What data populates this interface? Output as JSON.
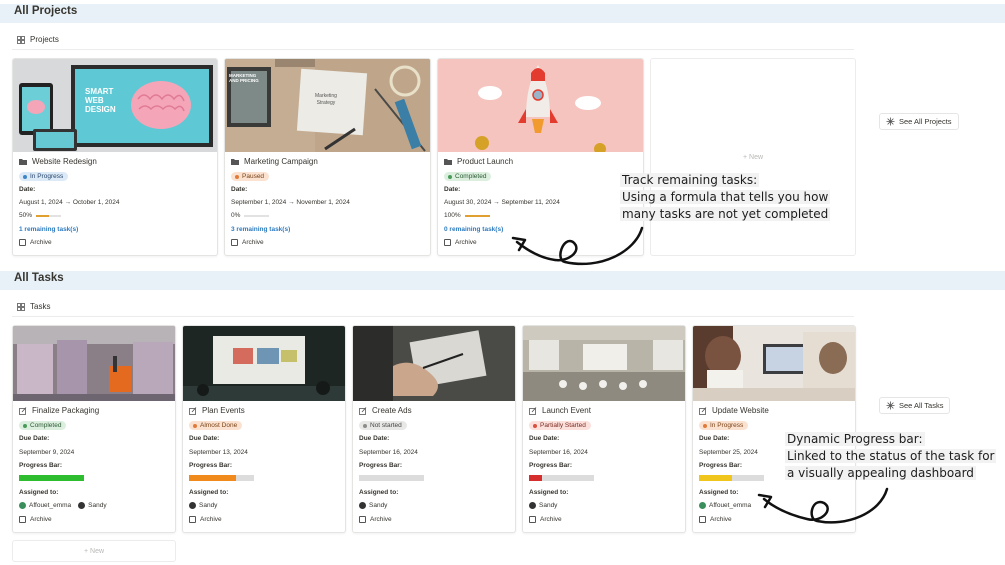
{
  "projects_section": {
    "title": "All Projects",
    "view_tab": "Projects",
    "see_all": "See All Projects",
    "new_label": "New"
  },
  "projects": [
    {
      "title": "Website Redesign",
      "status": "In Progress",
      "date_label": "Date:",
      "date": "August 1, 2024 → October 1, 2024",
      "percent_text": "50%",
      "percent": 0.5,
      "remaining": "1 remaining task(s)",
      "archive": "Archive",
      "cover_text_1": "SMART",
      "cover_text_2": "WEB",
      "cover_text_3": "DESIGN"
    },
    {
      "title": "Marketing Campaign",
      "status": "Paused",
      "date_label": "Date:",
      "date": "September 1, 2024 → November 1, 2024",
      "percent_text": "0%",
      "percent": 0,
      "remaining": "3 remaining task(s)",
      "archive": "Archive",
      "cover_text_1": "Marketing",
      "cover_text_2": "Strategy",
      "cover_text_3": "MARKETING AND PRICING"
    },
    {
      "title": "Product Launch",
      "status": "Completed",
      "date_label": "Date:",
      "date": "August 30, 2024 → September 11, 2024",
      "percent_text": "100%",
      "percent": 1,
      "remaining": "0 remaining task(s)",
      "archive": "Archive"
    }
  ],
  "tasks_section": {
    "title": "All Tasks",
    "view_tab": "Tasks",
    "see_all": "See All Tasks",
    "new_label": "New"
  },
  "tasks": [
    {
      "title": "Finalize Packaging",
      "status": "Completed",
      "due_label": "Due Date:",
      "due": "September 9, 2024",
      "progress_label": "Progress Bar:",
      "progress": 1,
      "assigned_label": "Assigned to:",
      "assignees": [
        "Affouet_emma",
        "Sandy"
      ],
      "archive": "Archive"
    },
    {
      "title": "Plan Events",
      "status": "Almost Done",
      "due_label": "Due Date:",
      "due": "September 13, 2024",
      "progress_label": "Progress Bar:",
      "progress": 0.72,
      "assigned_label": "Assigned to:",
      "assignees": [
        "Sandy"
      ],
      "archive": "Archive"
    },
    {
      "title": "Create Ads",
      "status": "Not started",
      "due_label": "Due Date:",
      "due": "September 16, 2024",
      "progress_label": "Progress Bar:",
      "progress": 0,
      "assigned_label": "Assigned to:",
      "assignees": [
        "Sandy"
      ],
      "archive": "Archive"
    },
    {
      "title": "Launch Event",
      "status": "Partially Started",
      "due_label": "Due Date:",
      "due": "September 16, 2024",
      "progress_label": "Progress Bar:",
      "progress": 0.2,
      "assigned_label": "Assigned to:",
      "assignees": [
        "Sandy"
      ],
      "archive": "Archive"
    },
    {
      "title": "Update Website",
      "status": "In Progress",
      "due_label": "Due Date:",
      "due": "September 25, 2024",
      "progress_label": "Progress Bar:",
      "progress": 0.5,
      "assigned_label": "Assigned to:",
      "assignees": [
        "Affouet_emma"
      ],
      "archive": "Archive"
    }
  ],
  "annotations": {
    "note1": [
      "Track remaining tasks:",
      "Using a formula that tells you how",
      "many tasks are not yet completed"
    ],
    "note2": [
      "Dynamic Progress bar:",
      "Linked to the status of the task for",
      "a visually appealing dashboard"
    ]
  },
  "colors": {
    "header_bg": "#e9f1f8",
    "link": "#2e7bc0",
    "in_progress": "#dbeaf6",
    "paused": "#fbe2d0",
    "completed": "#dcefdf",
    "almost_done": "#fbe2d0",
    "not_started": "#e8e8e6",
    "partially_started": "#fbe0dc",
    "bar_green": "#2ebd2e",
    "bar_orange": "#f08a1c",
    "bar_red": "#d62d2d",
    "bar_yellow": "#f0c51c"
  }
}
